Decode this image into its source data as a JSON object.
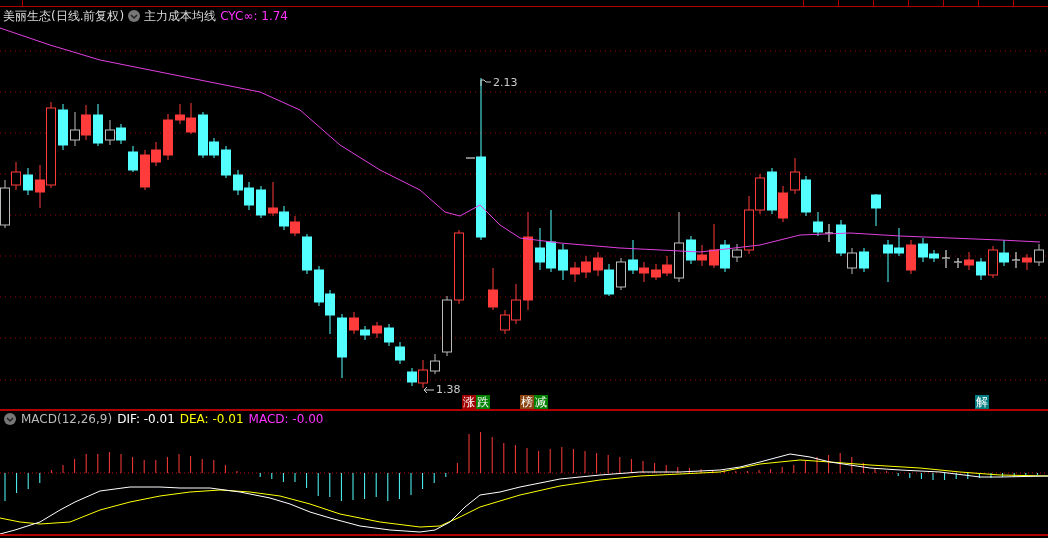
{
  "header": {
    "title": "美丽生态(日线.前复权)",
    "indicator": "主力成本均线",
    "reading": "CYC∞: 1.74"
  },
  "price_labels": [
    {
      "kind": "high",
      "text": "2.13"
    },
    {
      "kind": "low",
      "text": "1.38"
    }
  ],
  "markers": [
    {
      "chips": [
        {
          "text": "涨",
          "color": "#a00000"
        },
        {
          "text": "跌",
          "color": "#008000"
        }
      ]
    },
    {
      "chips": [
        {
          "text": "榜",
          "color": "#8b4513"
        },
        {
          "text": "减",
          "color": "#008000"
        }
      ]
    },
    {
      "chips": [
        {
          "text": "解",
          "color": "#007b80"
        }
      ]
    }
  ],
  "macd": {
    "name": "MACD(12,26,9)",
    "dif": "DIF: -0.01",
    "dea": "DEA: -0.01",
    "value": "MACD: -0.00"
  }
}
